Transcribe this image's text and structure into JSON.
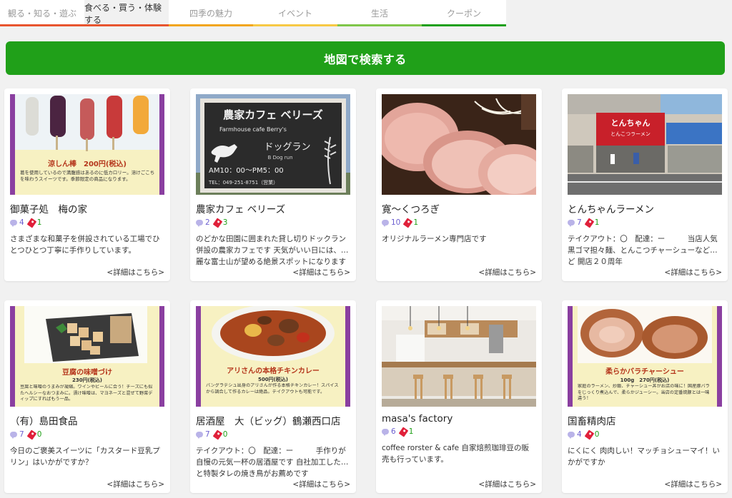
{
  "tabs": [
    {
      "label": "観る・知る・遊ぶ",
      "color": "#e8552f",
      "active": false
    },
    {
      "label": "食べる・買う・体験する",
      "color": "#e8552f",
      "active": true
    },
    {
      "label": "四季の魅力",
      "color": "#f2a51a",
      "active": false
    },
    {
      "label": "イベント",
      "color": "#f7c945",
      "active": false
    },
    {
      "label": "生活",
      "color": "#7fc64a",
      "active": false
    },
    {
      "label": "クーポン",
      "color": "#20a019",
      "active": false
    }
  ],
  "map_search": {
    "label": "地図で検索する",
    "color": "#20a019"
  },
  "more_label": "<詳細はこちら>",
  "cards": [
    {
      "title": "御菓子処　梅の家",
      "comments": "4",
      "clips": "1",
      "desc": "さまざまな和菓子を併設されている工場でひとつひとつ丁寧に手作りしています。",
      "thumb": {
        "banner": "涼しん棒　200円(税込)",
        "caption": "葛を使用しているので満腹感はあるのに低カロリー。溶けごこちを味わうスイーツです。季節限定の商品になります。"
      }
    },
    {
      "title": "農家カフェ ベリーズ",
      "comments": "2",
      "clips": "3",
      "desc": "のどかな田園に囲まれた貸し切りドックラン併設の農家カフェです 天気がいい日には、…麗な富士山が望める絶景スポットになります",
      "thumb": {
        "sign_title": "農家カフェ ベリーズ",
        "sign_sub": "Farmhouse cafe Berry's",
        "sign_brand": "ドッグラン",
        "sign_brand2": "B Dog run",
        "sign_hours": "AM10：00～PM5：00",
        "sign_tel": "TEL：049-251-8751（営業）"
      }
    },
    {
      "title": "寛～くつろぎ",
      "comments": "10",
      "clips": "1",
      "desc": "オリジナルラーメン専門店です",
      "thumb": {}
    },
    {
      "title": "とんちゃんラーメン",
      "comments": "7",
      "clips": "1",
      "desc": "テイクアウト：〇　配達：ー　　　当店人気黒ゴマ担々麺、とんこつチャーシューなど…ど 開店２０周年",
      "thumb": {
        "sign": "とんちゃん",
        "sign_sub": "とんこつラーメン"
      }
    },
    {
      "title": "（有）島田食品",
      "comments": "7",
      "clips": "0",
      "desc": "今日のご褒美スイーツに「カスタード豆乳プリン」はいかがですか？",
      "thumb": {
        "banner": "豆腐の味噌づけ",
        "price": "230円(税込)",
        "caption": "豆腐と味噌のうまみが凝縮。ワインやビールに合う！チーズにも似たヘルシーなおつまみに。漬け味噌は、マヨネーズと混ぜて野菜ディップにすればもう一品。"
      }
    },
    {
      "title": "居酒屋　大（ビッグ）鶴瀬西口店",
      "comments": "7",
      "clips": "0",
      "desc": "テイクアウト：〇　配達：ー　　　手作りが自慢の元気一杯の居酒屋です 自社加工した…と特製タレの焼き鳥がお薦めです",
      "thumb": {
        "banner": "アリさんの本格チキンカレー",
        "price": "500円(税込)",
        "caption": "バングラデシュ出身のアリさんが作る本格チキンカレー！スパイスから調合して作るカレーは絶品。テイクアウトも可能です。"
      }
    },
    {
      "title": "masa's factory",
      "comments": "6",
      "clips": "1",
      "desc": "coffee rorster & cafe 自家焙煎珈琲豆の販売も行っています。",
      "thumb": {}
    },
    {
      "title": "国畜精肉店",
      "comments": "4",
      "clips": "0",
      "desc": "にくにく 肉肉しい！マッチョシューマイ！いかがですか",
      "thumb": {
        "banner": "柔らかバラチャーシュー",
        "price": "100g　270円(税込)",
        "caption": "家庭のラーメン、炒飯、チャーシュー丼がお店の味に！国産豚バラをじっくり煮込んで、柔らかジューシー。当店の定番焼豚とは一味違う！"
      }
    }
  ]
}
